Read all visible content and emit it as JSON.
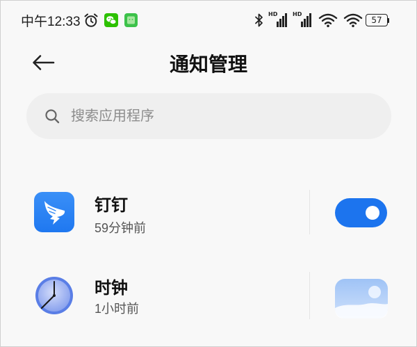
{
  "status_bar": {
    "time": "中午12:33",
    "left_icons": [
      "alarm-icon",
      "wechat-icon",
      "message-icon"
    ],
    "right_icons": [
      "bluetooth-icon",
      "signal-icon",
      "signal-icon",
      "wifi-icon",
      "wifi-icon",
      "battery-icon"
    ],
    "signal_label": "HD",
    "battery_level": "57"
  },
  "header": {
    "back_icon": "arrow-left-icon",
    "title": "通知管理"
  },
  "search": {
    "icon": "search-icon",
    "placeholder": "搜索应用程序"
  },
  "apps": [
    {
      "icon": "dingtalk-icon",
      "name": "钉钉",
      "last_notified": "59分钟前",
      "switch_state": "on"
    },
    {
      "icon": "clock-icon",
      "name": "时钟",
      "last_notified": "1小时前",
      "switch_state": "faded"
    }
  ],
  "colors": {
    "background": "#f8f8f8",
    "search_background": "#efefef",
    "accent": "#1c74ee",
    "dingtalk_blue": "#2e86f5",
    "wechat_green": "#2dc100"
  }
}
